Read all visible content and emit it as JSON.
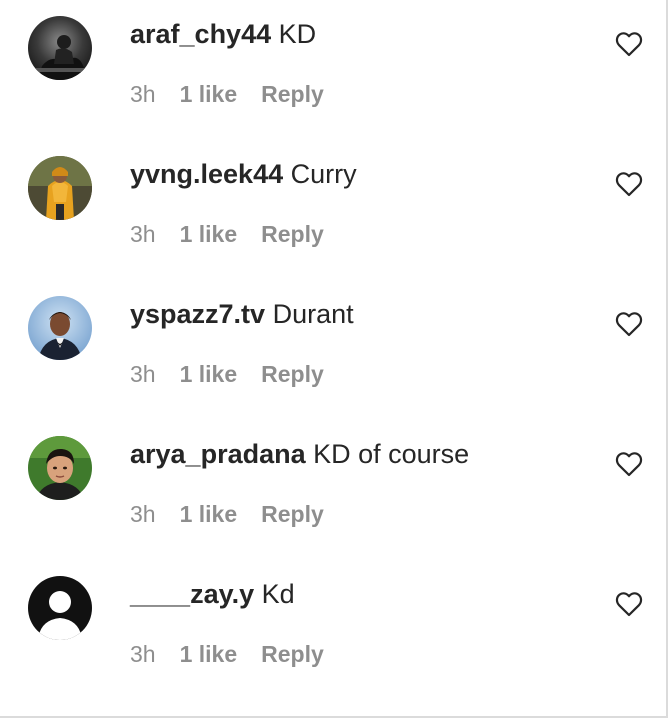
{
  "comments": [
    {
      "username": "araf_chy44",
      "text": "KD",
      "time": "3h",
      "likes": "1 like",
      "reply": "Reply",
      "avatar_icon": "avatar-dark-photo-icon",
      "like_icon": "heart-outline-icon"
    },
    {
      "username": "yvng.leek44",
      "text": "Curry",
      "time": "3h",
      "likes": "1 like",
      "reply": "Reply",
      "avatar_icon": "avatar-yellow-jacket-photo-icon",
      "like_icon": "heart-outline-icon"
    },
    {
      "username": "yspazz7.tv",
      "text": "Durant",
      "time": "3h",
      "likes": "1 like",
      "reply": "Reply",
      "avatar_icon": "avatar-portrait-blue-photo-icon",
      "like_icon": "heart-outline-icon"
    },
    {
      "username": "arya_pradana",
      "text": "KD of course",
      "time": "3h",
      "likes": "1 like",
      "reply": "Reply",
      "avatar_icon": "avatar-portrait-green-photo-icon",
      "like_icon": "heart-outline-icon"
    },
    {
      "username": "____zay.y",
      "text": "Kd",
      "time": "3h",
      "likes": "1 like",
      "reply": "Reply",
      "avatar_icon": "default-user-avatar-icon",
      "like_icon": "heart-outline-icon"
    }
  ],
  "colors": {
    "text_primary": "#262626",
    "text_secondary": "#8e8e8e",
    "border": "#dbdbdb",
    "background": "#ffffff"
  }
}
